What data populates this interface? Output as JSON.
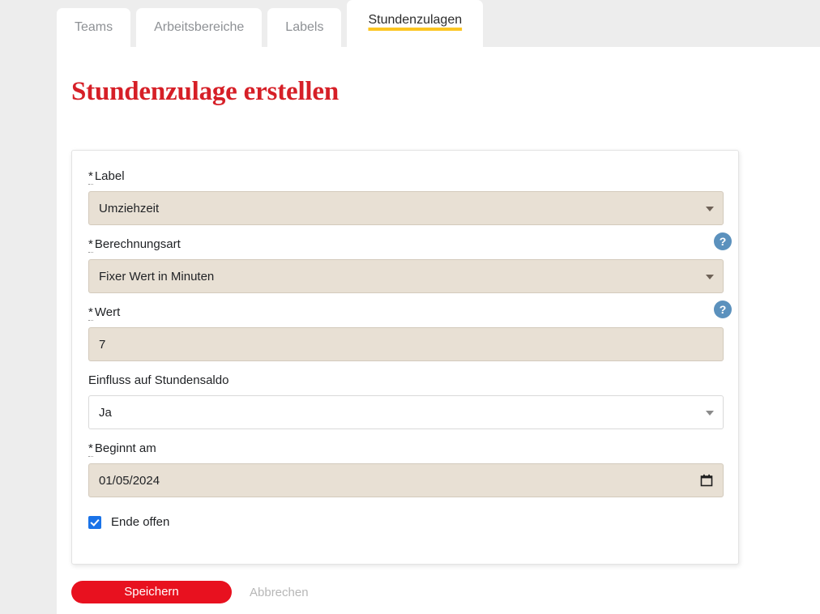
{
  "tabs": [
    {
      "label": "Teams",
      "active": false
    },
    {
      "label": "Arbeitsbereiche",
      "active": false
    },
    {
      "label": "Labels",
      "active": false
    },
    {
      "label": "Stundenzulagen",
      "active": true
    }
  ],
  "page": {
    "title": "Stundenzulage erstellen"
  },
  "form": {
    "label_field": {
      "label_star": "*",
      "label": "Label",
      "value": "Umziehzeit",
      "caret": "chevron-down-icon"
    },
    "calculation_field": {
      "label_star": "*",
      "label": "Berechnungsart",
      "value": "Fixer Wert in Minuten",
      "help": "?",
      "caret": "chevron-down-icon"
    },
    "value_field": {
      "label_star": "*",
      "label": "Wert",
      "value": "7",
      "help": "?"
    },
    "balance_field": {
      "label": "Einfluss auf Stundensaldo",
      "value": "Ja",
      "caret": "chevron-down-icon"
    },
    "start_field": {
      "label_star": "*",
      "label": "Beginnt am",
      "value": "01/05/2024",
      "icon": "calendar-icon"
    },
    "open_end": {
      "label": "Ende offen",
      "checked": true
    }
  },
  "actions": {
    "save_label": "Speichern",
    "cancel_label": "Abbrechen"
  },
  "colors": {
    "brand_red": "#d61f27",
    "button_red": "#e8111f",
    "tab_underline_yellow": "#fcc521",
    "autofill_beige": "#e8e0d4",
    "help_blue": "#5b91bd",
    "checkbox_blue": "#1a73e8",
    "page_bg": "#ededed"
  }
}
